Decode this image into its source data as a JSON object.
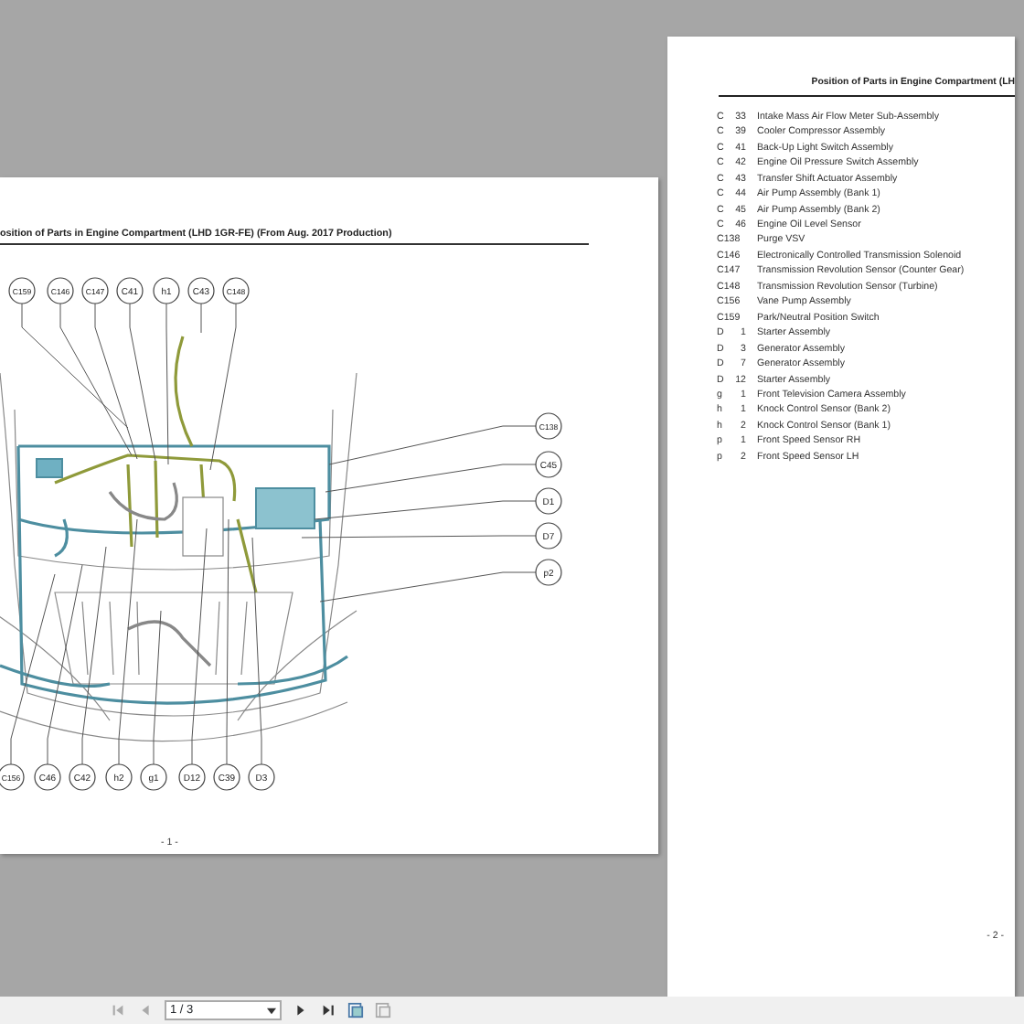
{
  "left_page": {
    "title": "osition of Parts in Engine Compartment (LHD 1GR-FE) (From Aug. 2017 Production)",
    "diagram": {
      "top_callouts": [
        "C159",
        "C146",
        "C147",
        "C41",
        "h1",
        "C43",
        "C148"
      ],
      "right_callouts": [
        "C138",
        "C45",
        "D1",
        "D7",
        "p2"
      ],
      "bottom_callouts": [
        "C156",
        "C46",
        "C42",
        "h2",
        "g1",
        "D12",
        "C39",
        "D3"
      ]
    },
    "page_number": "- 1 -"
  },
  "right_page": {
    "title": "Position of Parts in Engine Compartment (LH",
    "parts": [
      {
        "letter": "C",
        "number": "33",
        "name": "Intake Mass Air Flow Meter Sub-Assembly"
      },
      {
        "letter": "C",
        "number": "39",
        "name": "Cooler Compressor Assembly"
      },
      {
        "letter": "C",
        "number": "41",
        "name": "Back-Up Light Switch Assembly"
      },
      {
        "letter": "C",
        "number": "42",
        "name": "Engine Oil Pressure Switch Assembly"
      },
      {
        "letter": "C",
        "number": "43",
        "name": "Transfer Shift Actuator Assembly"
      },
      {
        "letter": "C",
        "number": "44",
        "name": "Air Pump Assembly (Bank 1)"
      },
      {
        "letter": "C",
        "number": "45",
        "name": "Air Pump Assembly (Bank 2)"
      },
      {
        "letter": "C",
        "number": "46",
        "name": "Engine Oil Level Sensor"
      },
      {
        "letter": "C138",
        "name": "Purge VSV"
      },
      {
        "letter": "C146",
        "name": "Electronically Controlled Transmission Solenoid"
      },
      {
        "letter": "C147",
        "name": "Transmission Revolution Sensor (Counter Gear)"
      },
      {
        "letter": "C148",
        "name": "Transmission Revolution Sensor (Turbine)"
      },
      {
        "letter": "C156",
        "name": "Vane Pump Assembly"
      },
      {
        "letter": "C159",
        "name": "Park/Neutral Position Switch"
      },
      {
        "letter": "D",
        "number": "1",
        "name": "Starter Assembly"
      },
      {
        "letter": "D",
        "number": "3",
        "name": "Generator Assembly"
      },
      {
        "letter": "D",
        "number": "7",
        "name": "Generator Assembly"
      },
      {
        "letter": "D",
        "number": "12",
        "name": "Starter Assembly"
      },
      {
        "letter": "g",
        "number": "1",
        "name": "Front Television Camera Assembly"
      },
      {
        "letter": "h",
        "number": "1",
        "name": "Knock Control Sensor (Bank 2)"
      },
      {
        "letter": "h",
        "number": "2",
        "name": "Knock Control Sensor (Bank 1)"
      },
      {
        "letter": "p",
        "number": "1",
        "name": "Front Speed Sensor RH"
      },
      {
        "letter": "p",
        "number": "2",
        "name": "Front Speed Sensor LH"
      }
    ],
    "page_number": "- 2 -"
  },
  "toolbar": {
    "page_field": "1 / 3"
  }
}
